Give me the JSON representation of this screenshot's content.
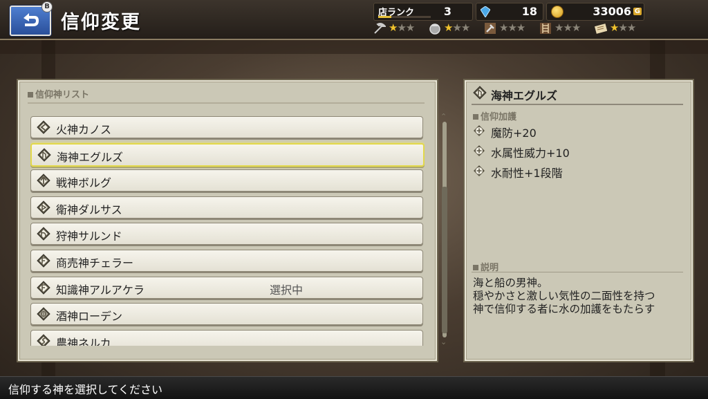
{
  "header": {
    "title": "信仰変更",
    "back_badge": "B",
    "shop_rank_label": "店ランク",
    "shop_rank_value": "3",
    "shop_rank_progress": 0.25,
    "gems": "18",
    "gold": "33006",
    "gold_unit": "G",
    "crafts": [
      {
        "icon": "pickaxe-icon",
        "stars_on": 1,
        "stars_total": 3
      },
      {
        "icon": "pot-icon",
        "stars_on": 1,
        "stars_total": 3
      },
      {
        "icon": "hammer-icon",
        "stars_on": 0,
        "stars_total": 3
      },
      {
        "icon": "ladder-icon",
        "stars_on": 0,
        "stars_total": 3
      },
      {
        "icon": "scroll-icon",
        "stars_on": 1,
        "stars_total": 3
      }
    ]
  },
  "list_panel": {
    "section_label": "信仰神リスト",
    "items": [
      {
        "name": "火神カノス",
        "status": "",
        "selected": false
      },
      {
        "name": "海神エグルズ",
        "status": "",
        "selected": true
      },
      {
        "name": "戦神ボルグ",
        "status": "",
        "selected": false
      },
      {
        "name": "衛神ダルサス",
        "status": "",
        "selected": false
      },
      {
        "name": "狩神サルンド",
        "status": "",
        "selected": false
      },
      {
        "name": "商売神チェラー",
        "status": "",
        "selected": false
      },
      {
        "name": "知識神アルアケラ",
        "status": "選択中",
        "selected": false
      },
      {
        "name": "酒神ローデン",
        "status": "",
        "selected": false
      },
      {
        "name": "農神ネルカ",
        "status": "",
        "selected": false
      }
    ]
  },
  "detail_panel": {
    "god_name": "海神エグルズ",
    "blessing_label": "信仰加護",
    "blessings": [
      "魔防+20",
      "水属性威力+10",
      "水耐性+1段階"
    ],
    "description_label": "説明",
    "description_lines": [
      "海と船の男神。",
      "穏やかさと激しい気性の二面性を持つ",
      "神で信仰する者に水の加護をもたらす"
    ]
  },
  "footer": {
    "hint": "信仰する神を選択してください"
  },
  "colors": {
    "selected_border": "#e2d84a",
    "panel_bg": "#cbc8b6",
    "star_on": "#f0c22c"
  }
}
